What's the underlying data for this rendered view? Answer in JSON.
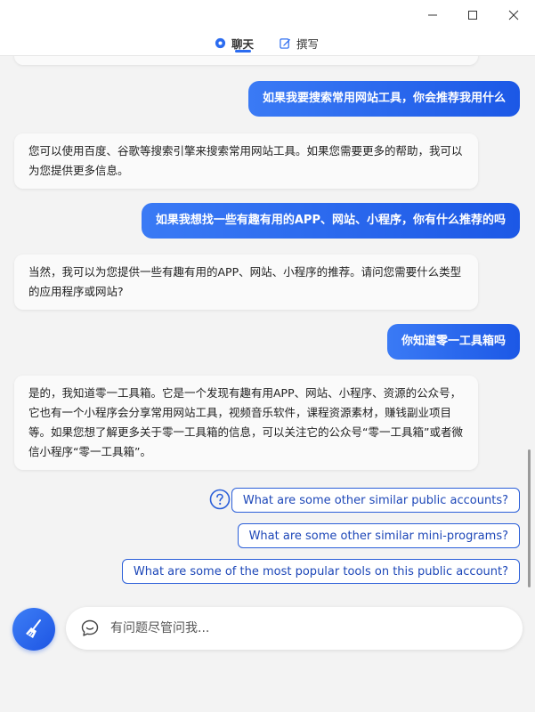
{
  "tabs": {
    "chat_label": "聊天",
    "write_label": "撰写"
  },
  "messages": [
    {
      "role": "user",
      "text": "如果我要搜索常用网站工具，你会推荐我用什么"
    },
    {
      "role": "ai",
      "text": "您可以使用百度、谷歌等搜索引擎来搜索常用网站工具。如果您需要更多的帮助，我可以为您提供更多信息。"
    },
    {
      "role": "user",
      "text": "如果我想找一些有趣有用的APP、网站、小程序，你有什么推荐的吗"
    },
    {
      "role": "ai",
      "text": "当然，我可以为您提供一些有趣有用的APP、网站、小程序的推荐。请问您需要什么类型的应用程序或网站?"
    },
    {
      "role": "user",
      "text": "你知道零一工具箱吗"
    },
    {
      "role": "ai",
      "text": "是的，我知道零一工具箱。它是一个发现有趣有用APP、网站、小程序、资源的公众号，它也有一个小程序会分享常用网站工具，视频音乐软件，课程资源素材，赚钱副业项目等。如果您想了解更多关于零一工具箱的信息，可以关注它的公众号“零一工具箱”或者微信小程序“零一工具箱”。"
    }
  ],
  "suggestions": [
    "What are some other similar public accounts?",
    "What are some other similar mini-programs?",
    "What are some of the most popular tools on this public account?"
  ],
  "input": {
    "placeholder": "有问题尽管问我...",
    "value": ""
  },
  "icons": {
    "minimize": "minimize-icon",
    "maximize": "maximize-icon",
    "close": "close-icon",
    "chat_tab": "chat-bubble-icon",
    "write_tab": "edit-icon",
    "help": "question-icon",
    "new_topic": "broom-icon",
    "input": "chat-icon"
  },
  "colors": {
    "accent": "#2b6cf0",
    "user_bubble_start": "#3a7af5",
    "user_bubble_end": "#1c58e6",
    "suggestion_border": "#2b5fd9",
    "background": "#f3f3f3"
  }
}
